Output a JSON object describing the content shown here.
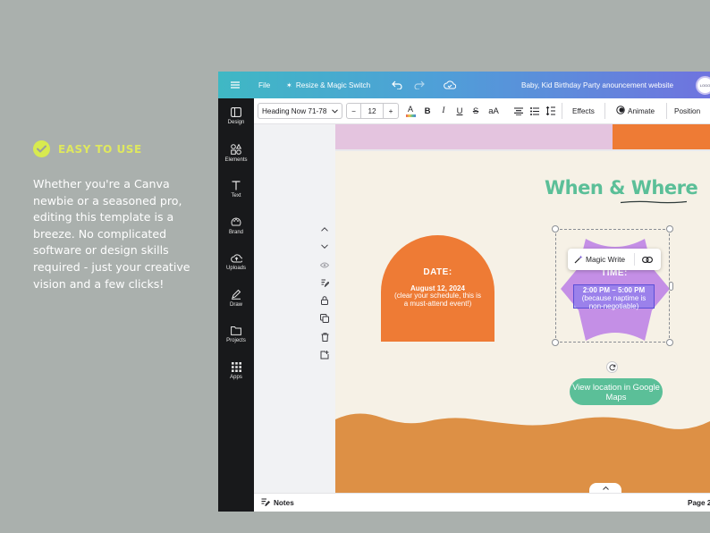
{
  "promo": {
    "title": "EASY TO USE",
    "body": "Whether you're a Canva newbie or a seasoned pro, editing this template is a breeze. No complicated software or design skills required - just your creative vision and a few clicks!"
  },
  "topbar": {
    "file_label": "File",
    "resize_label": "Resize & Magic Switch",
    "document_title": "Baby, Kid Birthday Party anouncement website",
    "avatar_text": "LOGO"
  },
  "sidebar": {
    "items": [
      {
        "label": "Design",
        "icon": "design-icon"
      },
      {
        "label": "Elements",
        "icon": "elements-icon"
      },
      {
        "label": "Text",
        "icon": "text-icon"
      },
      {
        "label": "Brand",
        "icon": "brand-icon"
      },
      {
        "label": "Uploads",
        "icon": "uploads-icon"
      },
      {
        "label": "Draw",
        "icon": "draw-icon"
      },
      {
        "label": "Projects",
        "icon": "projects-icon"
      },
      {
        "label": "Apps",
        "icon": "apps-icon"
      }
    ]
  },
  "toolbar": {
    "font_name": "Heading Now 71-78",
    "font_size": "12",
    "minus": "−",
    "plus": "+",
    "bold": "B",
    "italic": "I",
    "underline": "U",
    "strike": "S",
    "case": "aA",
    "text_color_glyph": "A",
    "effects": "Effects",
    "animate": "Animate",
    "position": "Position"
  },
  "canvas": {
    "heading_part1": "When & ",
    "heading_part2": "Where",
    "date_title": "DATE:",
    "date_value": "August 12, 2024",
    "date_note": "(clear your schedule, this is a must-attend event!)",
    "time_title": "TIME:",
    "time_value": "2:00 PM – 5:00 PM",
    "time_note": "(because naptime is non-negotiable)",
    "magic_write": "Magic Write",
    "map_button": "View location in Google Maps"
  },
  "bottombar": {
    "notes": "Notes",
    "page": "Page 2"
  },
  "colors": {
    "accent_green": "#5bbf98",
    "orange": "#ee7b35",
    "wave": "#dd9045",
    "lavender": "#c48fe6",
    "promo_title": "#dfe85e"
  }
}
